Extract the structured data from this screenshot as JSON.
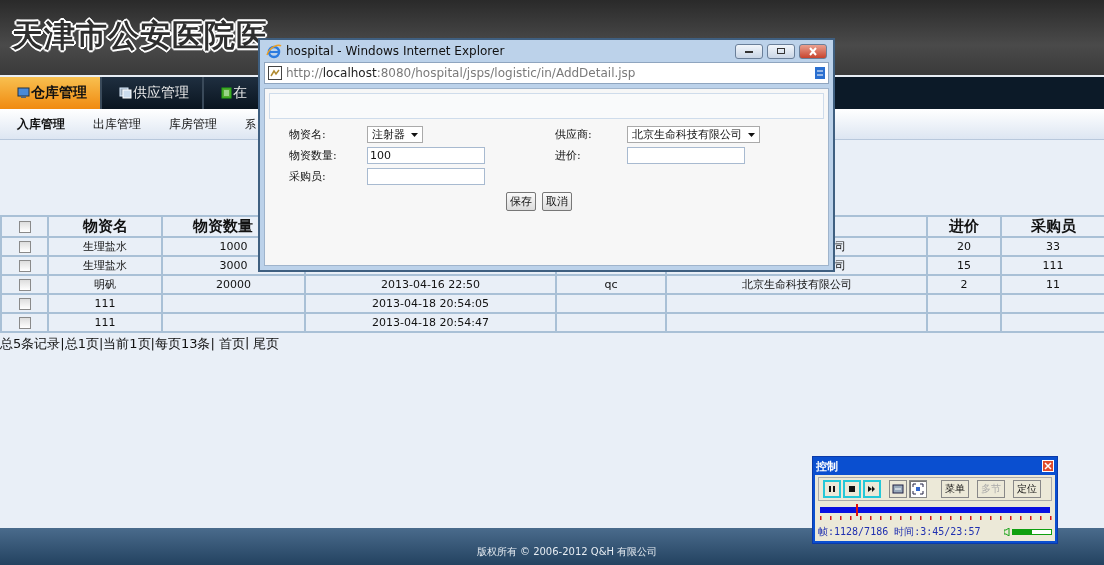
{
  "header": {
    "title": "天津市公安医院医"
  },
  "tabs": [
    {
      "label": "仓库管理",
      "selected": true
    },
    {
      "label": "供应管理",
      "selected": false
    },
    {
      "label": "在",
      "selected": false
    }
  ],
  "subnav": [
    {
      "label": "入库管理",
      "selected": true
    },
    {
      "label": "出库管理",
      "selected": false
    },
    {
      "label": "库房管理",
      "selected": false
    },
    {
      "label": "系",
      "selected": false
    }
  ],
  "table": {
    "select_all": {
      "checked": false
    },
    "columns": [
      {
        "label": "物资名"
      },
      {
        "label": "物资数量"
      },
      {},
      {},
      {},
      {
        "label": "进价"
      },
      {
        "label": "采购员"
      }
    ],
    "rows": [
      {
        "checked": false,
        "cells": [
          "生理盐水",
          "1000",
          null,
          null,
          {
            "text": "司",
            "cut": true
          },
          "20",
          "33"
        ]
      },
      {
        "checked": false,
        "cells": [
          "生理盐水",
          "3000",
          null,
          null,
          {
            "text": "司",
            "cut": true
          },
          "15",
          "111"
        ]
      },
      {
        "checked": false,
        "cells": [
          "明矾",
          "20000",
          "2013-04-16 22:50",
          "qc",
          "北京生命科技有限公司",
          "2",
          "11"
        ]
      },
      {
        "checked": false,
        "cells": [
          "111",
          null,
          "2013-04-18 20:54:05",
          null,
          null,
          null,
          null
        ]
      },
      {
        "checked": false,
        "cells": [
          "111",
          null,
          "2013-04-18 20:54:47",
          null,
          null,
          null,
          null
        ]
      }
    ]
  },
  "pagination": [
    {
      "kind": "text",
      "text": "总5条记录|总1页|当前1页|每页13条|"
    },
    {
      "kind": "link",
      "text": "首页"
    },
    {
      "kind": "text",
      "text": "|"
    },
    {
      "kind": "link",
      "text": "尾页"
    }
  ],
  "footer": {
    "text": "版权所有 © 2006-2012 Q&H 有限公司"
  },
  "popup": {
    "title": "hospital - Windows Internet Explorer",
    "address": {
      "scheme": "http://",
      "host": "localhost",
      "path": ":8080/hospital/jsps/logistic/in/AddDetail.jsp"
    },
    "left_fields": [
      {
        "label": "物资名:",
        "kind": "select",
        "value": "注射器"
      },
      {
        "label": "物资数量:",
        "kind": "input",
        "value": "100"
      },
      {
        "label": "采购员:",
        "kind": "input"
      }
    ],
    "right_fields": [
      {
        "label": "供应商:",
        "kind": "select",
        "value": "北京生命科技有限公司"
      },
      {
        "label": "进价:",
        "kind": "input"
      }
    ],
    "buttons": [
      "保存",
      "取消"
    ]
  },
  "control": {
    "title": "控制",
    "icon_buttons": [
      {
        "pressed": false
      },
      {
        "pressed": false
      },
      {
        "pressed": false
      },
      {
        "pressed": false
      },
      {
        "pressed": true
      }
    ],
    "buttons": [
      {
        "label": "菜单",
        "disabled": false
      },
      {
        "label": "多节",
        "disabled": true
      },
      {
        "label": "定位",
        "disabled": false
      }
    ],
    "progress": {
      "level": 0.157
    },
    "status": "帧:1128/7186 时间:3:45/23:57",
    "volume": {
      "level": 0.5
    }
  }
}
